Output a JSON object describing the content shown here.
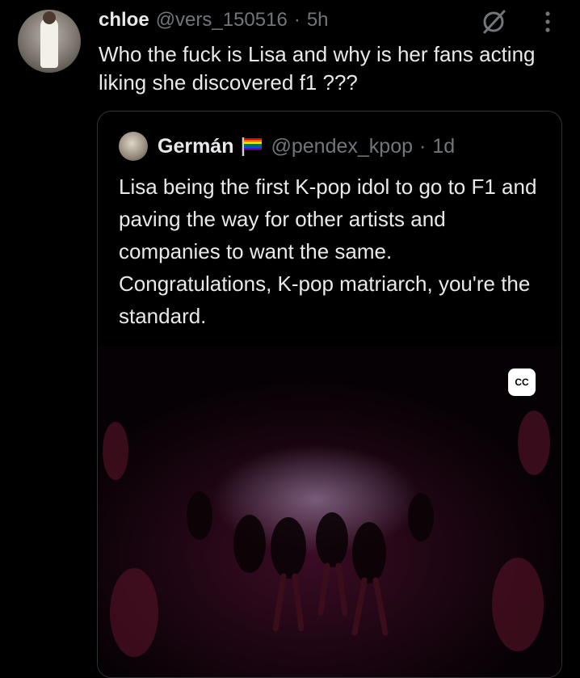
{
  "tweet": {
    "display_name": "chloe",
    "handle": "@vers_150516",
    "separator": "·",
    "timestamp": "5h",
    "text": "Who the fuck is Lisa and why is her fans acting liking she discovered f1 ???"
  },
  "quote": {
    "display_name": "Germán",
    "handle": "@pendex_kpop",
    "separator": "·",
    "timestamp": "1d",
    "text": "Lisa being the first K-pop idol to go to F1 and paving the way for other artists and companies to want the same. Congratulations, K-pop matriarch, you're the standard.",
    "media": {
      "caption_badge": "CC"
    }
  },
  "icons": {
    "grok": "grok-slash-circle-icon",
    "more": "vertical-ellipsis-icon",
    "flag": "rainbow-flag-emoji"
  },
  "colors": {
    "background": "#000000",
    "primary_text": "#e7e9ea",
    "secondary_text": "#71767b",
    "border": "#2f3336"
  }
}
